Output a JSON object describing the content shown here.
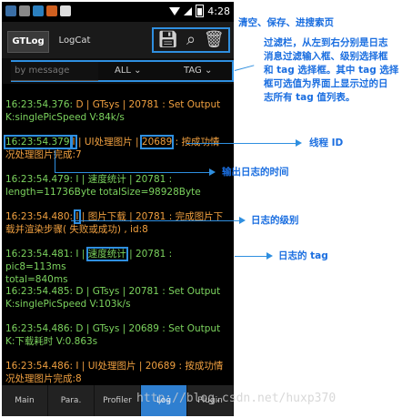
{
  "status": {
    "time": "4:28"
  },
  "toolbar": {
    "tabs": [
      "GTLog",
      "LogCat"
    ],
    "icons": [
      "save-icon",
      "search-icon",
      "trash-icon"
    ]
  },
  "filter": {
    "placeholder": "by message",
    "level": "ALL",
    "tag": "TAG"
  },
  "log": [
    {
      "time": "16:23:54.376",
      "lvl": "D",
      "pid": "20781",
      "tag": "GTsys",
      "msg": " | GTsys | 20781 : Set Output",
      "line2": "K:singlePicSpeed V:84k/s"
    },
    {
      "time": "16:23:54.379",
      "lvl": "I",
      "pid": "20689",
      "tag": "UI处理图片",
      "msg_a": " : ",
      "msg_b": "UI处理图片 | ",
      "msg_c": " : 按成功情",
      "line2": "况处理图片完成:7"
    },
    {
      "time": "16:23:54.479",
      "lvl": "I",
      "text": "16:23:54.479: I | 速度统计 | 20781 :",
      "line2": "length=11736Byte totalSize=98928Byte"
    },
    {
      "time": "16:23:54.480",
      "text_a": "16:23:54.480: ",
      "lvl": "I",
      "text_b": " | 图片下载 | 20781 : 完成图片下",
      "line2": "载并渲染步骤( 失败或成功) , id:8"
    },
    {
      "time": "16:23:54.481",
      "text_a": "16:23:54.481: I | ",
      "tag": "速度统计",
      "text_b": " | 20781 : pic8=113ms",
      "line2": "total=840ms"
    },
    {
      "text": "16:23:54.485: D | GTsys | 20781 : Set Output",
      "line2": "K:singlePicSpeed V:103k/s"
    },
    {
      "text": "16:23:54.486: D | GTsys | 20689 : Set Output",
      "line2": "K:下载耗时 V:0.863s"
    },
    {
      "text": "16:23:54.486: I | UI处理图片 | 20689 : 按成功情",
      "line2": "况处理图片完成:8"
    }
  ],
  "bottom_tabs": [
    "Main",
    "Para.",
    "Profiler",
    "Log",
    "Plugin"
  ],
  "annotations": {
    "toolbar": "清空、保存、进搜索页",
    "filter": [
      "过滤栏，从左到右分别是日志",
      "消息过滤输入框、级别选择框",
      "和 tag 选择框。其中 tag 选择",
      "框可选值为界面上显示过的日",
      "志所有 tag 值列表。"
    ],
    "pid": "线程 ID",
    "time": "输出日志的时间",
    "level": "日志的级别",
    "tag": "日志的 tag"
  },
  "watermark": "http://blog.csdn.net/huxp370"
}
